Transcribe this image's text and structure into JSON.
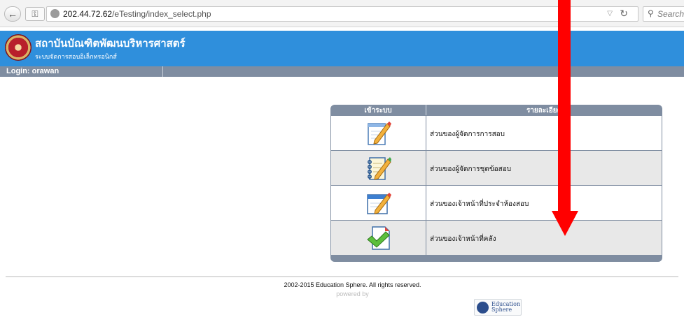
{
  "browser": {
    "url_host": "202.44.72.62",
    "url_path": "/eTesting/index_select.php",
    "search_placeholder": "Search",
    "back_icon": "left-arrow-icon",
    "identity_icon": "key-icon",
    "globe_icon": "globe-icon",
    "reload_icon": "reload-icon"
  },
  "header": {
    "title": "สถาบันบัณฑิตพัฒนบริหารศาสตร์",
    "subtitle": "ระบบจัดการสอบอิเล็กทรอนิกส์",
    "login_text": "Login: orawan",
    "colors": {
      "header_bg": "#2f8fdc",
      "login_bar_bg": "#7f8da1"
    }
  },
  "menu": {
    "col_enter": "เข้าระบบ",
    "col_details": "รายละเอียด",
    "items": [
      {
        "label": "ส่วนของผู้จัดการการสอบ",
        "icon": "pencil-document-icon"
      },
      {
        "label": "ส่วนของผู้จัดการชุดข้อสอบ",
        "icon": "notepad-pencil-icon"
      },
      {
        "label": "ส่วนของเจ้าหน้าที่ประจำห้องสอบ",
        "icon": "window-pencil-icon"
      },
      {
        "label": "ส่วนของเจ้าหน้าที่คลัง",
        "icon": "document-check-icon"
      }
    ]
  },
  "annotation": {
    "icon": "red-down-arrow-icon",
    "color": "#ff0000"
  },
  "footer": {
    "copyright": "2002-2015 Education Sphere. All rights reserved.",
    "powered_by": "powered by",
    "logo_line1": "Education",
    "logo_line2": "Sphere"
  }
}
